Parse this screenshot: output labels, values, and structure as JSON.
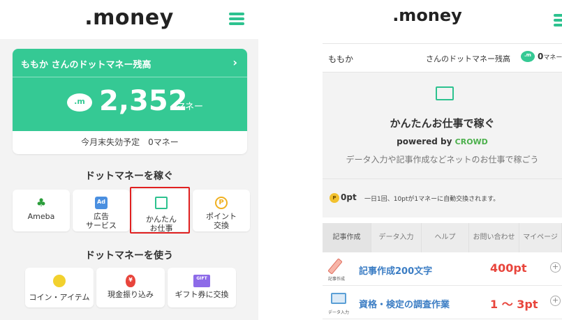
{
  "left": {
    "logo": ".money",
    "balance": {
      "title": "ももか さんのドットマネー残高",
      "amount": "2,352",
      "unit": "マネー",
      "expiry": "今月末失効予定　0マネー"
    },
    "earn_section": {
      "title": "ドットマネーを稼ぐ",
      "tiles": [
        {
          "label": "Ameba",
          "icon": "ameba-icon"
        },
        {
          "label": "広告\nサービス",
          "icon": "ad-icon"
        },
        {
          "label": "かんたん\nお仕事",
          "icon": "folder-icon"
        },
        {
          "label": "ポイント\n交換",
          "icon": "point-icon"
        }
      ]
    },
    "use_section": {
      "title": "ドットマネーを使う",
      "tiles": [
        {
          "label": "コイン・アイテム",
          "icon": "coin-stack-icon"
        },
        {
          "label": "現金振り込み",
          "icon": "cash-bag-icon"
        },
        {
          "label": "ギフト券に交換",
          "icon": "gift-icon",
          "icon_text": "GIFT"
        }
      ]
    }
  },
  "right": {
    "logo": ".money",
    "user": "ももか",
    "balance_label": "さんのドットマネー残高",
    "balance_value": "0",
    "balance_unit": "マネー",
    "hero": {
      "title": "かんたんお仕事で稼ぐ",
      "powered_by": "powered by ",
      "powered_brand": "CROWD",
      "subtitle": "データ入力や記事作成などネットのお仕事で稼ごう"
    },
    "points": {
      "badge": "P",
      "value": "0pt",
      "note": "一日1回、10ptが1マネーに自動交換されます。"
    },
    "tabs": [
      "記事作成",
      "データ入力",
      "ヘルプ",
      "お問い合わせ",
      "マイページ"
    ],
    "tasks": [
      {
        "category": "記事作成",
        "title": "記事作成200文字",
        "points": "400pt"
      },
      {
        "category": "データ入力",
        "title": "資格・検定の調査作業",
        "points": "1 ～ 3pt"
      }
    ]
  },
  "colors": {
    "brand_green": "#35c994",
    "highlight_red": "#e02020",
    "points_red": "#e8453c",
    "link_blue": "#3b7dc4"
  }
}
